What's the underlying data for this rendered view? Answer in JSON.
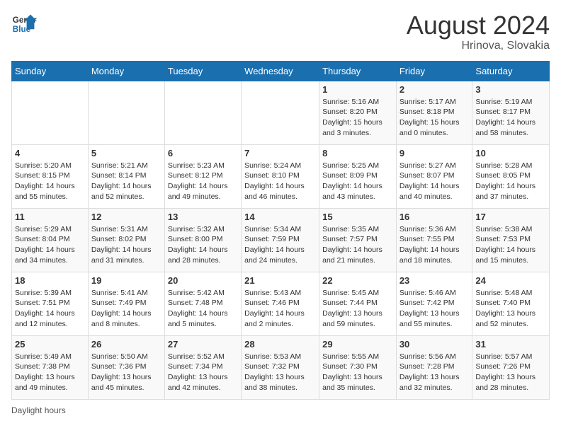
{
  "header": {
    "logo_line1": "General",
    "logo_line2": "Blue",
    "month_year": "August 2024",
    "location": "Hrinova, Slovakia"
  },
  "days_of_week": [
    "Sunday",
    "Monday",
    "Tuesday",
    "Wednesday",
    "Thursday",
    "Friday",
    "Saturday"
  ],
  "weeks": [
    [
      {
        "day": "",
        "info": ""
      },
      {
        "day": "",
        "info": ""
      },
      {
        "day": "",
        "info": ""
      },
      {
        "day": "",
        "info": ""
      },
      {
        "day": "1",
        "info": "Sunrise: 5:16 AM\nSunset: 8:20 PM\nDaylight: 15 hours\nand 3 minutes."
      },
      {
        "day": "2",
        "info": "Sunrise: 5:17 AM\nSunset: 8:18 PM\nDaylight: 15 hours\nand 0 minutes."
      },
      {
        "day": "3",
        "info": "Sunrise: 5:19 AM\nSunset: 8:17 PM\nDaylight: 14 hours\nand 58 minutes."
      }
    ],
    [
      {
        "day": "4",
        "info": "Sunrise: 5:20 AM\nSunset: 8:15 PM\nDaylight: 14 hours\nand 55 minutes."
      },
      {
        "day": "5",
        "info": "Sunrise: 5:21 AM\nSunset: 8:14 PM\nDaylight: 14 hours\nand 52 minutes."
      },
      {
        "day": "6",
        "info": "Sunrise: 5:23 AM\nSunset: 8:12 PM\nDaylight: 14 hours\nand 49 minutes."
      },
      {
        "day": "7",
        "info": "Sunrise: 5:24 AM\nSunset: 8:10 PM\nDaylight: 14 hours\nand 46 minutes."
      },
      {
        "day": "8",
        "info": "Sunrise: 5:25 AM\nSunset: 8:09 PM\nDaylight: 14 hours\nand 43 minutes."
      },
      {
        "day": "9",
        "info": "Sunrise: 5:27 AM\nSunset: 8:07 PM\nDaylight: 14 hours\nand 40 minutes."
      },
      {
        "day": "10",
        "info": "Sunrise: 5:28 AM\nSunset: 8:05 PM\nDaylight: 14 hours\nand 37 minutes."
      }
    ],
    [
      {
        "day": "11",
        "info": "Sunrise: 5:29 AM\nSunset: 8:04 PM\nDaylight: 14 hours\nand 34 minutes."
      },
      {
        "day": "12",
        "info": "Sunrise: 5:31 AM\nSunset: 8:02 PM\nDaylight: 14 hours\nand 31 minutes."
      },
      {
        "day": "13",
        "info": "Sunrise: 5:32 AM\nSunset: 8:00 PM\nDaylight: 14 hours\nand 28 minutes."
      },
      {
        "day": "14",
        "info": "Sunrise: 5:34 AM\nSunset: 7:59 PM\nDaylight: 14 hours\nand 24 minutes."
      },
      {
        "day": "15",
        "info": "Sunrise: 5:35 AM\nSunset: 7:57 PM\nDaylight: 14 hours\nand 21 minutes."
      },
      {
        "day": "16",
        "info": "Sunrise: 5:36 AM\nSunset: 7:55 PM\nDaylight: 14 hours\nand 18 minutes."
      },
      {
        "day": "17",
        "info": "Sunrise: 5:38 AM\nSunset: 7:53 PM\nDaylight: 14 hours\nand 15 minutes."
      }
    ],
    [
      {
        "day": "18",
        "info": "Sunrise: 5:39 AM\nSunset: 7:51 PM\nDaylight: 14 hours\nand 12 minutes."
      },
      {
        "day": "19",
        "info": "Sunrise: 5:41 AM\nSunset: 7:49 PM\nDaylight: 14 hours\nand 8 minutes."
      },
      {
        "day": "20",
        "info": "Sunrise: 5:42 AM\nSunset: 7:48 PM\nDaylight: 14 hours\nand 5 minutes."
      },
      {
        "day": "21",
        "info": "Sunrise: 5:43 AM\nSunset: 7:46 PM\nDaylight: 14 hours\nand 2 minutes."
      },
      {
        "day": "22",
        "info": "Sunrise: 5:45 AM\nSunset: 7:44 PM\nDaylight: 13 hours\nand 59 minutes."
      },
      {
        "day": "23",
        "info": "Sunrise: 5:46 AM\nSunset: 7:42 PM\nDaylight: 13 hours\nand 55 minutes."
      },
      {
        "day": "24",
        "info": "Sunrise: 5:48 AM\nSunset: 7:40 PM\nDaylight: 13 hours\nand 52 minutes."
      }
    ],
    [
      {
        "day": "25",
        "info": "Sunrise: 5:49 AM\nSunset: 7:38 PM\nDaylight: 13 hours\nand 49 minutes."
      },
      {
        "day": "26",
        "info": "Sunrise: 5:50 AM\nSunset: 7:36 PM\nDaylight: 13 hours\nand 45 minutes."
      },
      {
        "day": "27",
        "info": "Sunrise: 5:52 AM\nSunset: 7:34 PM\nDaylight: 13 hours\nand 42 minutes."
      },
      {
        "day": "28",
        "info": "Sunrise: 5:53 AM\nSunset: 7:32 PM\nDaylight: 13 hours\nand 38 minutes."
      },
      {
        "day": "29",
        "info": "Sunrise: 5:55 AM\nSunset: 7:30 PM\nDaylight: 13 hours\nand 35 minutes."
      },
      {
        "day": "30",
        "info": "Sunrise: 5:56 AM\nSunset: 7:28 PM\nDaylight: 13 hours\nand 32 minutes."
      },
      {
        "day": "31",
        "info": "Sunrise: 5:57 AM\nSunset: 7:26 PM\nDaylight: 13 hours\nand 28 minutes."
      }
    ]
  ],
  "footer": {
    "label": "Daylight hours"
  }
}
